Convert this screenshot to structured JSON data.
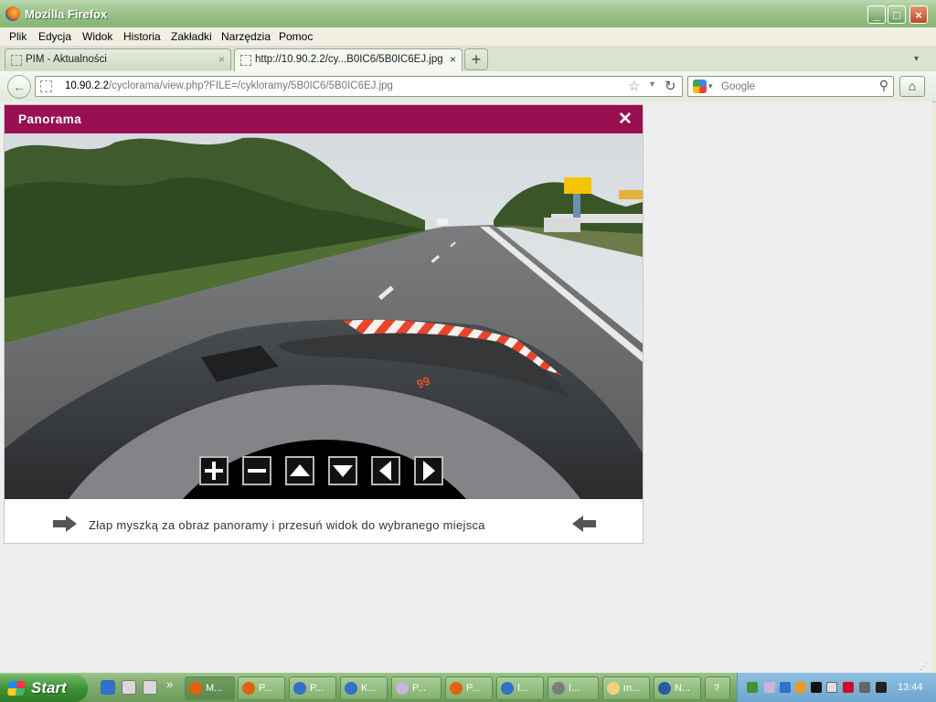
{
  "window": {
    "title": "Mozilla Firefox",
    "minimize": "_",
    "maximize": "□",
    "close": "×"
  },
  "menu": [
    "Plik",
    "Edycja",
    "Widok",
    "Historia",
    "Zakładki",
    "Narzędzia",
    "Pomoc"
  ],
  "tabs": [
    {
      "label": "PIM - Aktualności",
      "close": "×"
    },
    {
      "label": "http://10.90.2.2/cy...B0IC6/5B0IC6EJ.jpg",
      "close": "×"
    }
  ],
  "tab_new": "+",
  "tab_list": "▾",
  "nav": {
    "back": "←",
    "url_host": "10.90.2.2",
    "url_path": "/cyclorama/view.php?FILE=/cykloramy/5B0IC6/5B0IC6EJ.jpg",
    "star": "☆",
    "dropdown": "▾",
    "reload": "↻",
    "search_placeholder": "Google",
    "search_icon": "⚲",
    "home": "⌂"
  },
  "panel": {
    "title": "Panorama",
    "close": "✕",
    "hint": "Złap myszką za obraz panoramy i przesuń widok do wybranego miejsca",
    "controls": [
      {
        "name": "zoom-in-button",
        "icon": "zoom-in-icon"
      },
      {
        "name": "zoom-out-button",
        "icon": "zoom-out-icon"
      },
      {
        "name": "pan-up-button",
        "icon": "arrow-up-icon"
      },
      {
        "name": "pan-down-button",
        "icon": "arrow-down-icon"
      },
      {
        "name": "pan-left-button",
        "icon": "arrow-left-icon"
      },
      {
        "name": "pan-right-button",
        "icon": "arrow-right-icon"
      }
    ],
    "brand_colors": {
      "header": "#9a0f52",
      "sign": "#f5c400"
    }
  },
  "taskbar": {
    "start": "Start",
    "overflow": "»",
    "tasks": [
      {
        "label": "M..."
      },
      {
        "label": "P..."
      },
      {
        "label": "P..."
      },
      {
        "label": "K..."
      },
      {
        "label": "P..."
      },
      {
        "label": "P..."
      },
      {
        "label": "I..."
      },
      {
        "label": "I..."
      },
      {
        "label": "m..."
      },
      {
        "label": "N..."
      },
      {
        "label": "?"
      }
    ],
    "clock": "13:44"
  }
}
